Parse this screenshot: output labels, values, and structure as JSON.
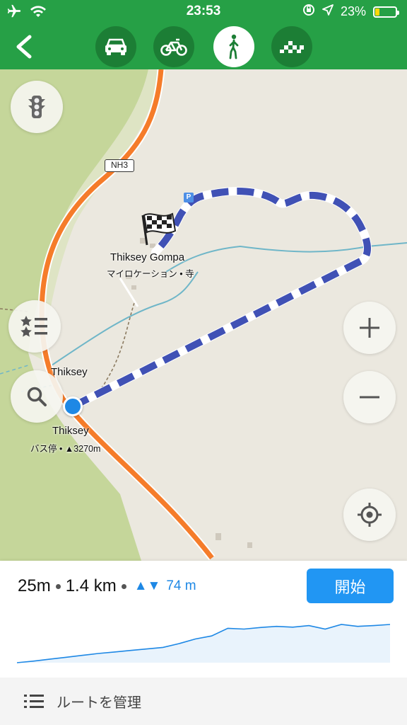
{
  "status": {
    "time": "23:53",
    "battery_percent": "23%",
    "battery_level": 0.23,
    "icons": [
      "airplane-icon",
      "wifi-icon",
      "orientation-lock-icon",
      "location-arrow-icon",
      "battery-icon"
    ]
  },
  "nav": {
    "back_icon": "chevron-left-icon",
    "modes": [
      {
        "name": "car",
        "icon": "car-icon"
      },
      {
        "name": "bike",
        "icon": "bicycle-icon"
      },
      {
        "name": "walk",
        "icon": "pedestrian-icon",
        "active": true
      },
      {
        "name": "taxi",
        "icon": "taxi-icon"
      }
    ],
    "colors": {
      "bar": "#26a046",
      "mode_bg": "#1c7e35"
    }
  },
  "map": {
    "road_label": "NH3",
    "parking_label": "P",
    "destination": {
      "name": "Thiksey Gompa",
      "subtitle": "マイロケーション • 寺"
    },
    "place_label": "Thiksey",
    "bus_stop": {
      "name": "Thiksey",
      "subtitle": "バス停 • ▲3270m"
    },
    "colors": {
      "route": "#4051b5",
      "road": "#f57c2a",
      "water": "#6fb6c8",
      "land": "#c5d69a"
    }
  },
  "panel": {
    "time": "25m",
    "distance": "1.4 km",
    "elevation_arrows": "▲▼",
    "elevation": "74 m",
    "start_button": "開始",
    "manage_routes": "ルートを管理",
    "elevation_profile": [
      0.0,
      0.04,
      0.09,
      0.14,
      0.19,
      0.24,
      0.28,
      0.32,
      0.36,
      0.4,
      0.5,
      0.62,
      0.7,
      0.9,
      0.88,
      0.92,
      0.95,
      0.93,
      0.97,
      0.88,
      1.0,
      0.95,
      0.97,
      1.0
    ]
  }
}
